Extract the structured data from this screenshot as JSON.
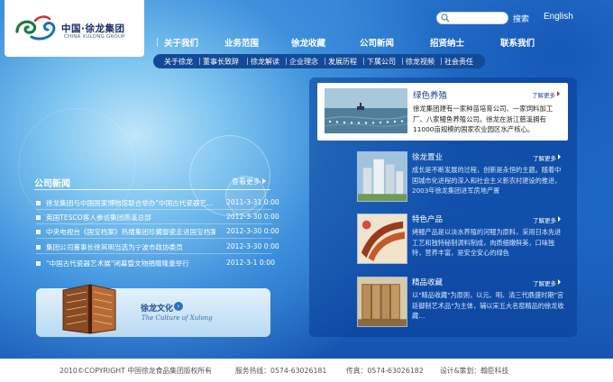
{
  "logo": {
    "name_cn": "中国·徐龙集团",
    "name_en": "CHINA XULONG GROUP"
  },
  "header": {
    "search_placeholder": "",
    "search_label": "搜索",
    "lang_label": "English"
  },
  "main_nav": [
    "关于我们",
    "业务范围",
    "徐龙收藏",
    "公司新闻",
    "招贤纳士",
    "联系我们"
  ],
  "sub_nav": [
    "关于徐龙",
    "董事长致辞",
    "徐龙解读",
    "企业理念",
    "发展历程",
    "下属公司",
    "徐龙视频",
    "社会责任"
  ],
  "news": {
    "title": "公司新闻",
    "more": "查看更多",
    "items": [
      {
        "text": "徐龙集团与中国国家博物馆联合举办\"中国古代瓷器艺…",
        "date": "2011-3-31 0:00"
      },
      {
        "text": "英国TESCO客人参访集团燕溪总部",
        "date": "2012-3-30 0:00"
      },
      {
        "text": "中央电视台《国宝档案》热播集团珍藏御瓷走进国宝档案",
        "date": "2012-3-30 0:00"
      },
      {
        "text": "集团公司董事长徐其明当选为宁波市政协委员",
        "date": "2012-3-30 0:00"
      },
      {
        "text": "\"中国古代瓷器艺术展\"闭幕暨文物捐赠隆重举行",
        "date": "2012-3-1 0:00"
      }
    ]
  },
  "culture": {
    "title": "徐龙文化",
    "subtitle": "The Culture of Xulong"
  },
  "feature": {
    "title": "绿色养殖",
    "more": "了解更多",
    "desc": "徐龙集团建有一家种苗培育公司、一家饲料加工厂、八家鳗鱼养殖公司。徐龙在浙江慈溪拥有11000亩规模的国家农业园区水产核心。"
  },
  "items": [
    {
      "title": "徐龙置业",
      "more": "了解更多",
      "desc": "成长是不断发展的过程，创新是永恒的主题。随着中国城市化进程的深入和社会主义新农村建设的推进，2003年徐龙集团进军房地产置"
    },
    {
      "title": "特色产品",
      "more": "了解更多",
      "desc": "烤鳗产品是以淡水养殖的河鳗为原料，采用日本先进工艺和独特秘制调料制成，肉质细嫩鲜美，口味独特，营养丰富，是安全安心的绿色"
    },
    {
      "title": "精品收藏",
      "more": "了解更多",
      "desc": "以\"精品收藏\"为原则，以元、明、清三代鼎盛时期\"宫廷御制艺术品\"为主体，辅以宋五大名窑精品的徐龙收藏…"
    }
  ],
  "footer": {
    "copyright": "2010©COPYRIGHT 中国徐龙食品集团版权所有",
    "hotline": "服务热线：0574-63026181",
    "fax": "传真：0574-63026182",
    "design": "设计&策划：翰臣科技"
  },
  "colors": {
    "brand_blue": "#1a5fbd",
    "nav_dark": "#134a97",
    "accent_red": "#c8261d"
  }
}
